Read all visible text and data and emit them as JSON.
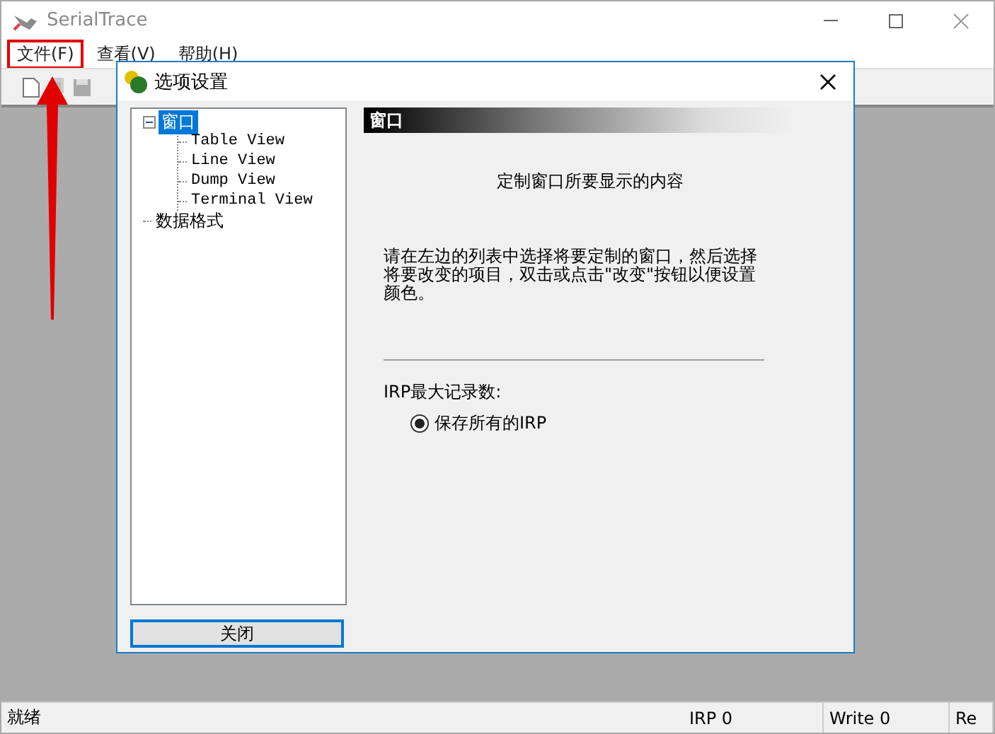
{
  "window": {
    "title": "SerialTrace"
  },
  "menu": [
    {
      "label": "文件(F)",
      "highlighted": true
    },
    {
      "label": "查看(V)",
      "highlighted": false
    },
    {
      "label": "帮助(H)",
      "highlighted": false
    }
  ],
  "dialog": {
    "title": "选项设置",
    "tree": [
      {
        "label": "窗口",
        "selected": true,
        "expanded": true,
        "children": [
          {
            "label": "Table View",
            "selected": false
          },
          {
            "label": "Line View",
            "selected": false
          },
          {
            "label": "Dump View",
            "selected": false
          },
          {
            "label": "Terminal View",
            "selected": false
          }
        ]
      },
      {
        "label": "数据格式",
        "selected": false
      }
    ],
    "close_button": "关闭",
    "panel": {
      "header": "窗口",
      "heading": "定制窗口所要显示的内容",
      "description": "请在左边的列表中选择将要定制的窗口，然后选择将要改变的项目，双击或点击\"改变\"按钮以便设置颜色。",
      "group_label": "IRP最大记录数:",
      "radios": [
        {
          "label": "保存所有的IRP",
          "selected": true
        }
      ]
    }
  },
  "status_bar": [
    "就绪",
    "IRP 0",
    "Write 0",
    "Re"
  ]
}
